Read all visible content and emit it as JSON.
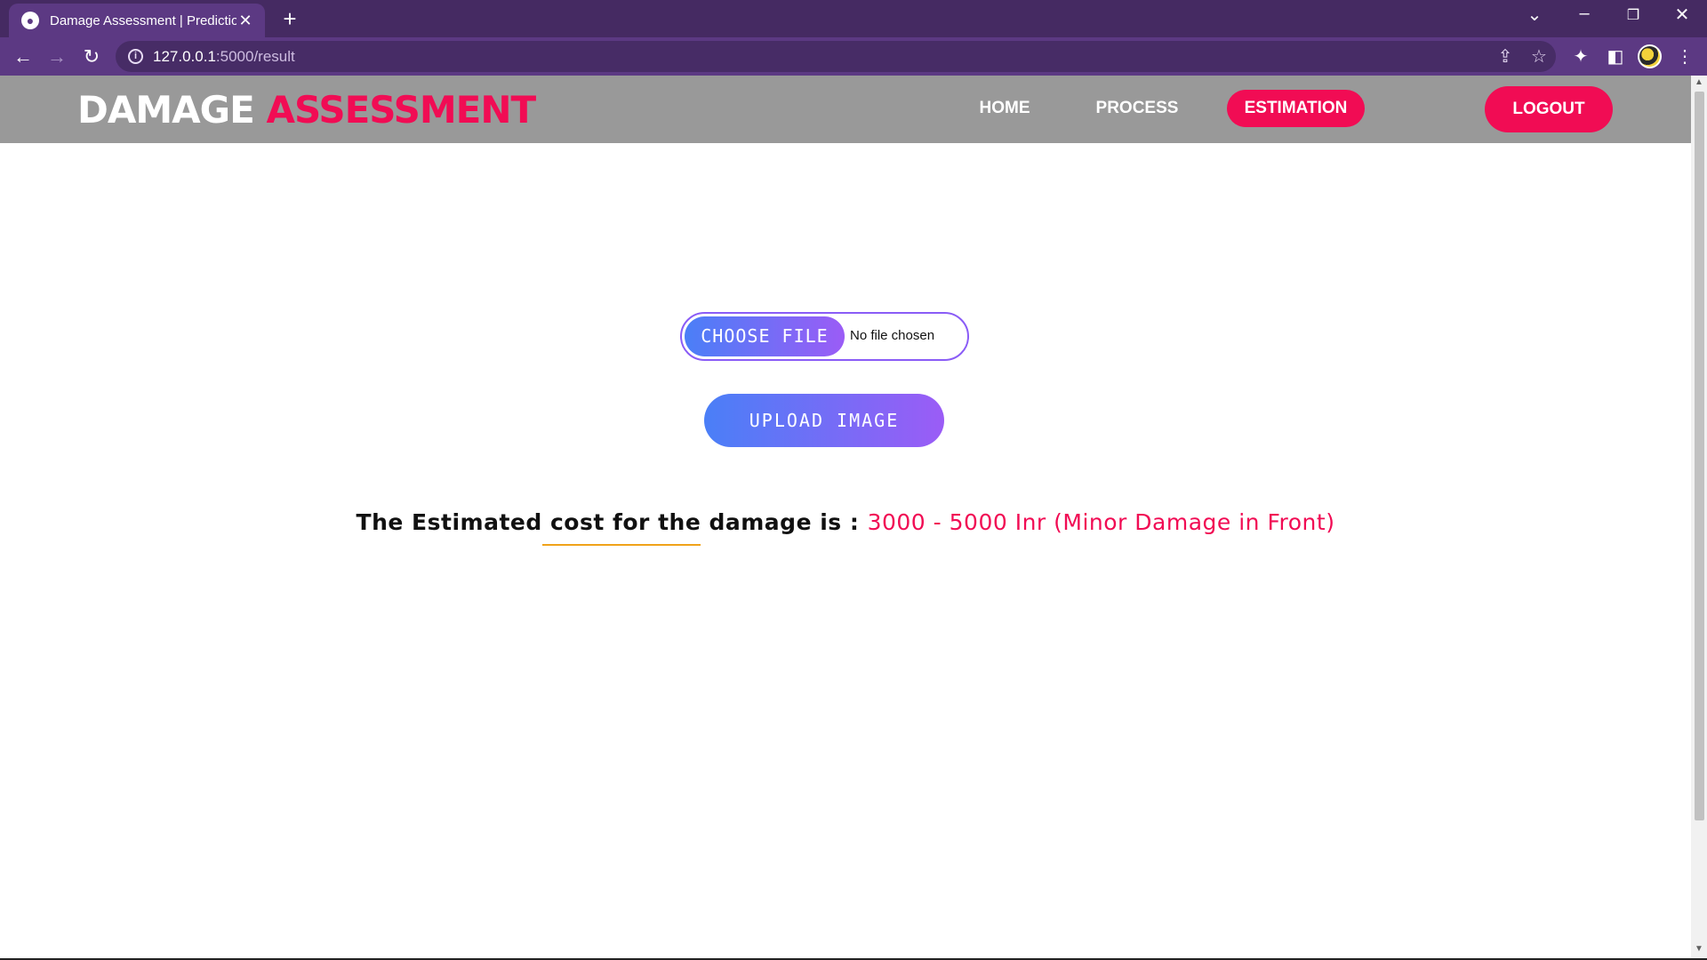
{
  "browser": {
    "tab_title": "Damage Assessment | Prediction",
    "tab_favicon": "globe-icon",
    "url_host": "127.0.0.1",
    "url_rest": ":5000/result"
  },
  "site": {
    "brand_part1": "DAMAGE",
    "brand_part2": "ASSESSMENT",
    "nav": {
      "home": "HOME",
      "process": "PROCESS",
      "estimation": "ESTIMATION",
      "logout": "LOGOUT"
    },
    "active_nav": "ESTIMATION"
  },
  "upload": {
    "choose_label": "CHOOSE FILE",
    "file_status": "No file chosen",
    "upload_label": "UPLOAD IMAGE"
  },
  "result": {
    "label": "The Estimated cost for the damage is :",
    "value": "3000 - 5000 Inr (Minor Damage in Front)"
  },
  "colors": {
    "accent": "#f10c54",
    "header_bg": "#999999",
    "chrome_bg": "#5c3983",
    "gradient_start": "#4a7ff7",
    "gradient_end": "#9b5cf6",
    "underline": "#f0a31a"
  }
}
